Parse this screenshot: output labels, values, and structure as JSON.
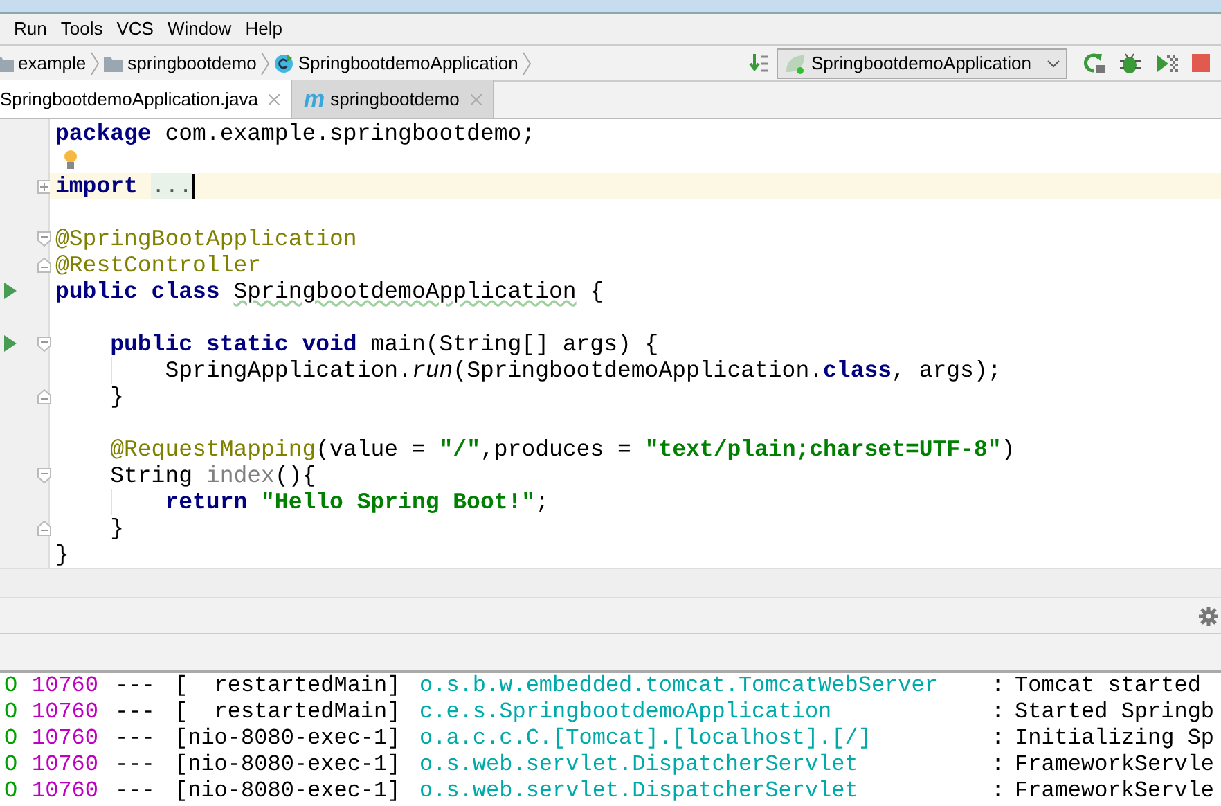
{
  "menu": [
    {
      "label": "Run"
    },
    {
      "label": "Tools"
    },
    {
      "label": "VCS"
    },
    {
      "label": "Window"
    },
    {
      "label": "Help"
    }
  ],
  "breadcrumbs": [
    {
      "label": "example",
      "kind": "folder"
    },
    {
      "label": "springbootdemo",
      "kind": "folder"
    },
    {
      "label": "SpringbootdemoApplication",
      "kind": "class"
    }
  ],
  "run_config": {
    "label": "SpringbootdemoApplication"
  },
  "tabs": [
    {
      "label": "SpringbootdemoApplication.java",
      "selected": true
    },
    {
      "label": "springbootdemo",
      "icon_text": "m",
      "selected": false
    }
  ],
  "code": [
    {
      "tokens": [
        {
          "kind": "keyword",
          "text": "package"
        },
        {
          "kind": "plain",
          "text": " com.example.springbootdemo;"
        }
      ]
    },
    {
      "bulb": true
    },
    {
      "current": true,
      "collapsed": true,
      "caret": true,
      "tokens": [
        {
          "kind": "keyword",
          "text": "import "
        },
        {
          "kind": "folded",
          "text": "..."
        }
      ]
    },
    {
      "gap_before": true,
      "fold_start": true,
      "tokens": [
        {
          "kind": "annotation",
          "text": "@SpringBootApplication"
        }
      ]
    },
    {
      "fold_end": true,
      "tokens": [
        {
          "kind": "annotation",
          "text": "@RestController"
        }
      ]
    },
    {
      "run": true,
      "tokens": [
        {
          "kind": "keyword",
          "text": "public class "
        },
        {
          "kind": "typo",
          "text": "SpringbootdemoApplication"
        },
        {
          "kind": "plain",
          "text": " {"
        }
      ]
    },
    {
      "gap_before": true,
      "run": true,
      "fold_start": true,
      "tokens": [
        {
          "kind": "keyword",
          "text": "    public static void"
        },
        {
          "kind": "plain",
          "text": " main(String[] args) {"
        }
      ]
    },
    {
      "guide": true,
      "tokens": [
        {
          "kind": "plain",
          "text": "        SpringApplication."
        },
        {
          "kind": "italic",
          "text": "run"
        },
        {
          "kind": "plain",
          "text": "(SpringbootdemoApplication."
        },
        {
          "kind": "keyword",
          "text": "class"
        },
        {
          "kind": "plain",
          "text": ", args);"
        }
      ]
    },
    {
      "fold_end": true,
      "tokens": [
        {
          "kind": "plain",
          "text": "    }"
        }
      ]
    },
    {
      "gap_before": true,
      "tokens": [
        {
          "kind": "annotation",
          "text": "    @RequestMapping"
        },
        {
          "kind": "plain",
          "text": "(value = "
        },
        {
          "kind": "string",
          "text": "\"/\""
        },
        {
          "kind": "plain",
          "text": ",produces = "
        },
        {
          "kind": "string",
          "text": "\"text/plain;charset=UTF-8\""
        },
        {
          "kind": "plain",
          "text": ")"
        }
      ]
    },
    {
      "fold_start": true,
      "tokens": [
        {
          "kind": "plain",
          "text": "    String "
        },
        {
          "kind": "unused",
          "text": "index"
        },
        {
          "kind": "plain",
          "text": "(){"
        }
      ]
    },
    {
      "guide": true,
      "tokens": [
        {
          "kind": "keyword",
          "text": "        return "
        },
        {
          "kind": "string",
          "text": "\"Hello Spring Boot!\""
        },
        {
          "kind": "plain",
          "text": ";"
        }
      ]
    },
    {
      "fold_end": true,
      "tokens": [
        {
          "kind": "plain",
          "text": "    }"
        }
      ]
    },
    {
      "tokens": [
        {
          "kind": "plain",
          "text": "}"
        }
      ]
    }
  ],
  "log": [
    {
      "level": "O",
      "pid": "10760",
      "sep": "---",
      "thread": "[  restartedMain]",
      "logger": "o.s.b.w.embedded.tomcat.TomcatWebServer",
      "colon": ":",
      "message": "Tomcat started"
    },
    {
      "level": "O",
      "pid": "10760",
      "sep": "---",
      "thread": "[  restartedMain]",
      "logger": "c.e.s.SpringbootdemoApplication",
      "colon": ":",
      "message": "Started Springb"
    },
    {
      "level": "O",
      "pid": "10760",
      "sep": "---",
      "thread": "[nio-8080-exec-1]",
      "logger": "o.a.c.c.C.[Tomcat].[localhost].[/]",
      "colon": ":",
      "message": "Initializing Sp"
    },
    {
      "level": "O",
      "pid": "10760",
      "sep": "---",
      "thread": "[nio-8080-exec-1]",
      "logger": "o.s.web.servlet.DispatcherServlet",
      "colon": ":",
      "message": "FrameworkServle"
    },
    {
      "level": "O",
      "pid": "10760",
      "sep": "---",
      "thread": "[nio-8080-exec-1]",
      "logger": "o.s.web.servlet.DispatcherServlet",
      "colon": ":",
      "message": "FrameworkServle"
    }
  ]
}
